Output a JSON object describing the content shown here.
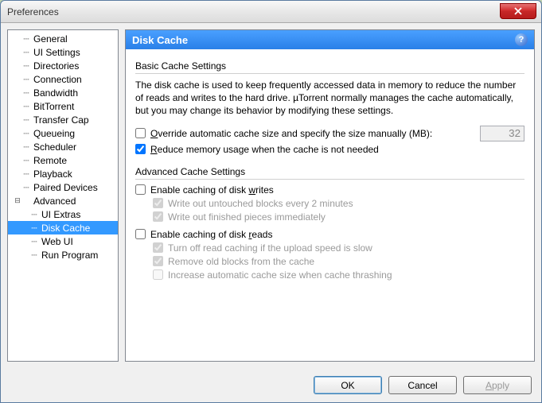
{
  "window": {
    "title": "Preferences"
  },
  "tree": {
    "items": [
      {
        "label": "General"
      },
      {
        "label": "UI Settings"
      },
      {
        "label": "Directories"
      },
      {
        "label": "Connection"
      },
      {
        "label": "Bandwidth"
      },
      {
        "label": "BitTorrent"
      },
      {
        "label": "Transfer Cap"
      },
      {
        "label": "Queueing"
      },
      {
        "label": "Scheduler"
      },
      {
        "label": "Remote"
      },
      {
        "label": "Playback"
      },
      {
        "label": "Paired Devices"
      }
    ],
    "advanced": {
      "label": "Advanced",
      "expanded": true,
      "items": [
        {
          "label": "UI Extras"
        },
        {
          "label": "Disk Cache",
          "selected": true
        },
        {
          "label": "Web UI"
        },
        {
          "label": "Run Program"
        }
      ]
    }
  },
  "panel": {
    "title": "Disk Cache",
    "basic": {
      "heading": "Basic Cache Settings",
      "description": "The disk cache is used to keep frequently accessed data in memory to reduce the number of reads and writes to the hard drive. µTorrent normally manages the cache automatically, but you may change its behavior by modifying these settings.",
      "override_label": "Override automatic cache size and specify the size manually (MB):",
      "override_checked": false,
      "size_value": "32",
      "reduce_label": "Reduce memory usage when the cache is not needed",
      "reduce_checked": true
    },
    "advanced": {
      "heading": "Advanced Cache Settings",
      "writes_label": "Enable caching of disk writes",
      "writes_checked": false,
      "write_untouched_label": "Write out untouched blocks every 2 minutes",
      "write_untouched_checked": true,
      "write_finished_label": "Write out finished pieces immediately",
      "write_finished_checked": true,
      "reads_label": "Enable caching of disk reads",
      "reads_checked": false,
      "turnoff_label": "Turn off read caching if the upload speed is slow",
      "turnoff_checked": true,
      "remove_old_label": "Remove old blocks from the cache",
      "remove_old_checked": true,
      "increase_label": "Increase automatic cache size when cache thrashing",
      "increase_checked": false
    }
  },
  "buttons": {
    "ok": "OK",
    "cancel": "Cancel",
    "apply": "Apply"
  }
}
